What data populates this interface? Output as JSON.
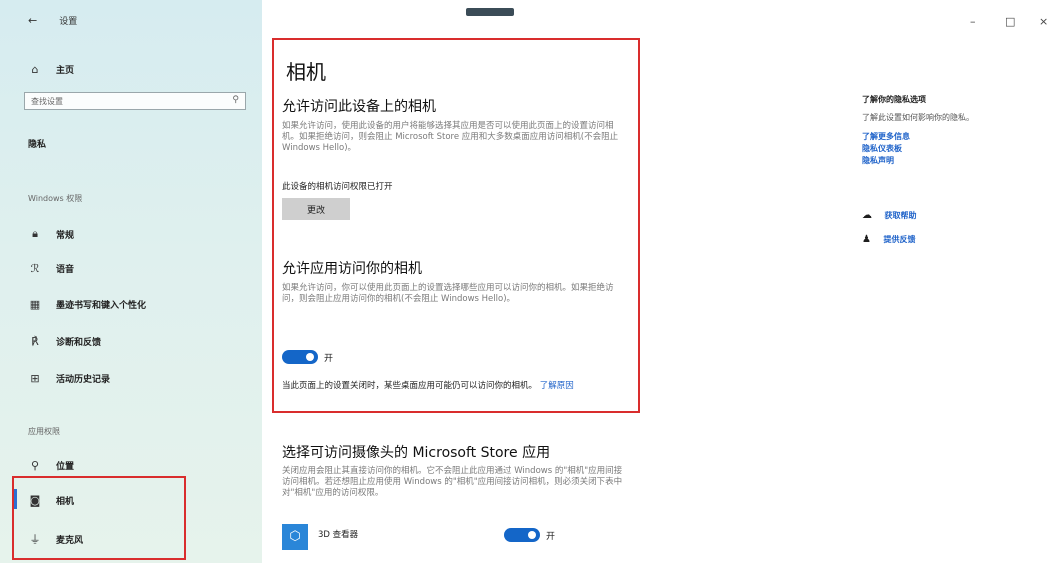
{
  "window": {
    "title": "设置",
    "minimize": "–",
    "maximize": "□",
    "close": "×"
  },
  "sidebar": {
    "home": "主页",
    "search_placeholder": "查找设置",
    "category": "隐私",
    "windows_permissions_title": "Windows 权限",
    "items": [
      {
        "label": "常规",
        "icon": "lock-icon"
      },
      {
        "label": "语音",
        "icon": "speech-icon"
      },
      {
        "label": "墨迹书写和键入个性化",
        "icon": "keyboard-icon"
      },
      {
        "label": "诊断和反馈",
        "icon": "feedback-icon"
      },
      {
        "label": "活动历史记录",
        "icon": "history-icon"
      }
    ],
    "app_permissions_title": "应用权限",
    "app_items": [
      {
        "label": "位置",
        "icon": "location-icon"
      },
      {
        "label": "相机",
        "icon": "camera-icon",
        "active": true
      },
      {
        "label": "麦克风",
        "icon": "microphone-icon"
      }
    ]
  },
  "main": {
    "title": "相机",
    "section1": {
      "heading": "允许访问此设备上的相机",
      "desc": "如果允许访问，使用此设备的用户将能够选择其应用是否可以使用此页面上的设置访问相机。如果拒绝访问，则会阻止 Microsoft Store 应用和大多数桌面应用访问相机(不会阻止 Windows Hello)。",
      "status": "此设备的相机访问权限已打开",
      "change_button": "更改"
    },
    "section2": {
      "heading": "允许应用访问你的相机",
      "desc": "如果允许访问，你可以使用此页面上的设置选择哪些应用可以访问你的相机。如果拒绝访问，则会阻止应用访问你的相机(不会阻止 Windows Hello)。",
      "toggle_label": "开",
      "toggle_on": true,
      "note": "当此页面上的设置关闭时，某些桌面应用可能仍可以访问你的相机。",
      "note_link": "了解原因"
    },
    "section3": {
      "heading": "选择可访问摄像头的 Microsoft Store 应用",
      "desc": "关闭应用会阻止其直接访问你的相机。它不会阻止此应用通过 Windows 的\"相机\"应用间接访问相机。若还想阻止应用使用 Windows 的\"相机\"应用间接访问相机，则必须关闭下表中对\"相机\"应用的访问权限。",
      "app_name": "3D 查看器",
      "app_toggle_label": "开"
    }
  },
  "right_panel": {
    "title": "了解你的隐私选项",
    "subtitle": "了解此设置如何影响你的隐私。",
    "links": [
      "了解更多信息",
      "隐私仪表板",
      "隐私声明"
    ],
    "help": "获取帮助",
    "feedback": "提供反馈"
  },
  "colors": {
    "accent": "#1466c8",
    "highlight_box": "#d92d2d"
  }
}
